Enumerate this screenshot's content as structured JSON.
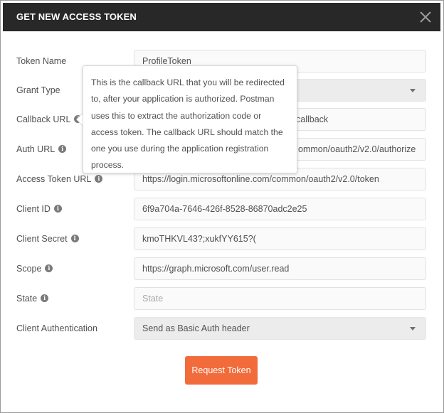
{
  "dialog": {
    "title": "GET NEW ACCESS TOKEN"
  },
  "fields": {
    "token_name": {
      "label": "Token Name",
      "value": "ProfileToken"
    },
    "grant_type": {
      "label": "Grant Type",
      "value": ""
    },
    "callback_url": {
      "label": "Callback URL",
      "value": "callback"
    },
    "auth_url": {
      "label": "Auth URL",
      "value": "ommon/oauth2/v2.0/authorize"
    },
    "access_token_url": {
      "label": "Access Token URL",
      "value": "https://login.microsoftonline.com/common/oauth2/v2.0/token"
    },
    "client_id": {
      "label": "Client ID",
      "value": "6f9a704a-7646-426f-8528-86870adc2e25"
    },
    "client_secret": {
      "label": "Client Secret",
      "value": "kmoTHKVL43?;xukfYY615?("
    },
    "scope": {
      "label": "Scope",
      "value": "https://graph.microsoft.com/user.read"
    },
    "state": {
      "label": "State",
      "value": "",
      "placeholder": "State"
    },
    "client_authentication": {
      "label": "Client Authentication",
      "value": "Send as Basic Auth header"
    }
  },
  "tooltip": {
    "text": "This is the callback URL that you will be redirected to, after your application is authorized. Postman uses this to extract the authorization code or access token. The callback URL should match the one you use during the application registration process."
  },
  "actions": {
    "request_token_label": "Request Token"
  },
  "icons": {
    "info": "info-icon",
    "close": "close-icon",
    "dropdown": "chevron-down-icon"
  },
  "colors": {
    "header_bg": "#282828",
    "primary_button": "#f26b3a",
    "label_text": "#505050"
  }
}
